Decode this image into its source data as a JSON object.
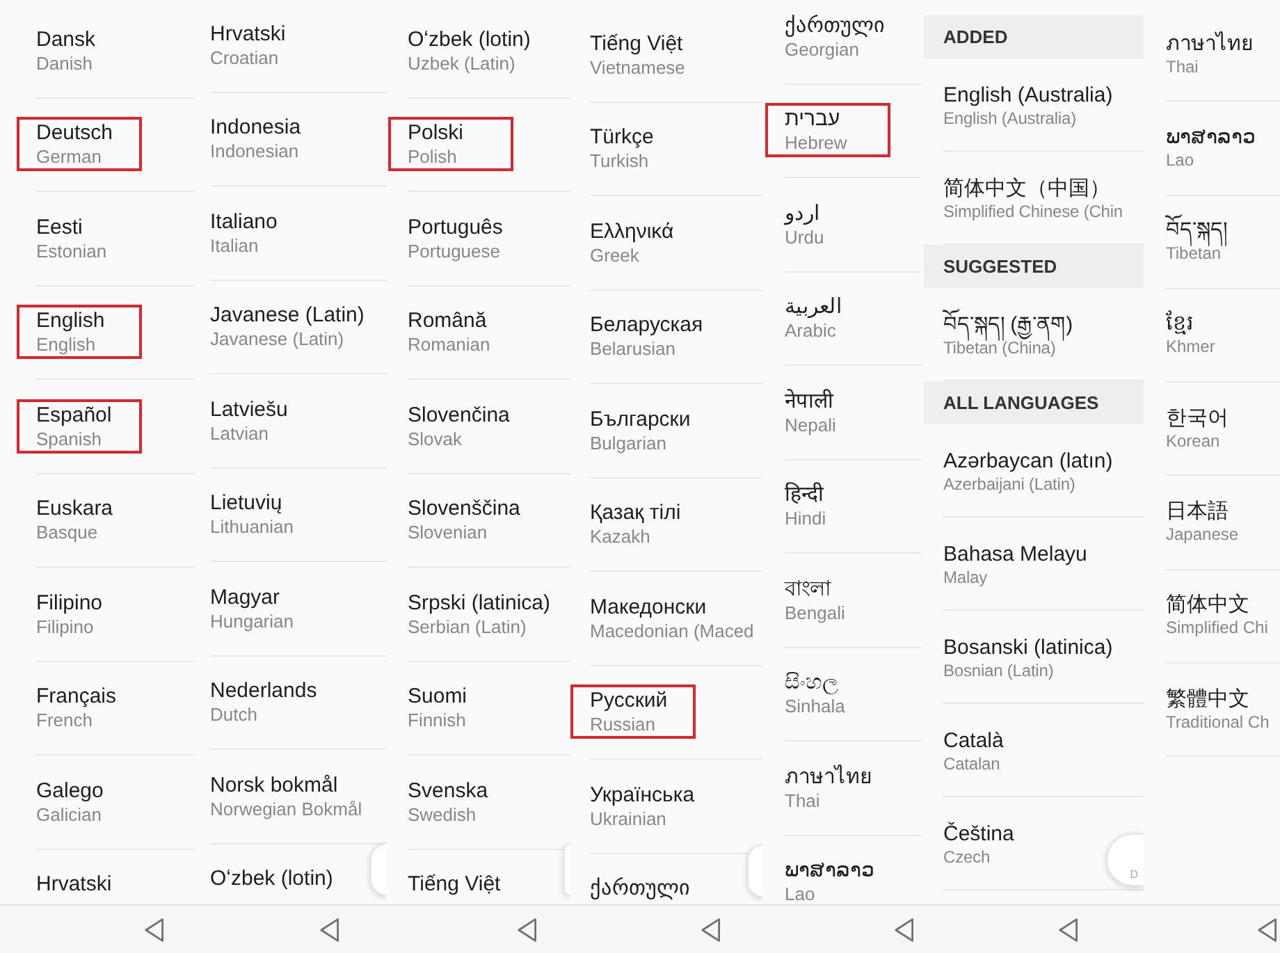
{
  "strips": [
    {
      "floating_button": false,
      "items": [
        {
          "kind": "language",
          "name": "Dansk",
          "english_name": "Danish",
          "highlighted": false
        },
        {
          "kind": "language",
          "name": "Deutsch",
          "english_name": "German",
          "highlighted": true
        },
        {
          "kind": "language",
          "name": "Eesti",
          "english_name": "Estonian",
          "highlighted": false
        },
        {
          "kind": "language",
          "name": "English",
          "english_name": "English",
          "highlighted": true
        },
        {
          "kind": "language",
          "name": "Español",
          "english_name": "Spanish",
          "highlighted": true
        },
        {
          "kind": "language",
          "name": "Euskara",
          "english_name": "Basque",
          "highlighted": false
        },
        {
          "kind": "language",
          "name": "Filipino",
          "english_name": "Filipino",
          "highlighted": false
        },
        {
          "kind": "language",
          "name": "Français",
          "english_name": "French",
          "highlighted": false
        },
        {
          "kind": "language",
          "name": "Galego",
          "english_name": "Galician",
          "highlighted": false
        },
        {
          "kind": "language",
          "name": "Hrvatski",
          "highlighted": false
        }
      ]
    },
    {
      "floating_button": true,
      "items": [
        {
          "kind": "language",
          "name": "Hrvatski",
          "english_name": "Croatian",
          "highlighted": false
        },
        {
          "kind": "language",
          "name": "Indonesia",
          "english_name": "Indonesian",
          "highlighted": false
        },
        {
          "kind": "language",
          "name": "Italiano",
          "english_name": "Italian",
          "highlighted": false
        },
        {
          "kind": "language",
          "name": "Javanese (Latin)",
          "english_name": "Javanese (Latin)",
          "highlighted": false
        },
        {
          "kind": "language",
          "name": "Latviešu",
          "english_name": "Latvian",
          "highlighted": false
        },
        {
          "kind": "language",
          "name": "Lietuvių",
          "english_name": "Lithuanian",
          "highlighted": false
        },
        {
          "kind": "language",
          "name": "Magyar",
          "english_name": "Hungarian",
          "highlighted": false
        },
        {
          "kind": "language",
          "name": "Nederlands",
          "english_name": "Dutch",
          "highlighted": false
        },
        {
          "kind": "language",
          "name": "Norsk bokmål",
          "english_name": "Norwegian Bokmål",
          "highlighted": false
        },
        {
          "kind": "language",
          "name": "Oʻzbek (lotin)",
          "highlighted": false
        }
      ]
    },
    {
      "floating_button": true,
      "items": [
        {
          "kind": "language",
          "name": "Oʻzbek (lotin)",
          "english_name": "Uzbek (Latin)",
          "highlighted": false
        },
        {
          "kind": "language",
          "name": "Polski",
          "english_name": "Polish",
          "highlighted": true
        },
        {
          "kind": "language",
          "name": "Português",
          "english_name": "Portuguese",
          "highlighted": false
        },
        {
          "kind": "language",
          "name": "Română",
          "english_name": "Romanian",
          "highlighted": false
        },
        {
          "kind": "language",
          "name": "Slovenčina",
          "english_name": "Slovak",
          "highlighted": false
        },
        {
          "kind": "language",
          "name": "Slovenščina",
          "english_name": "Slovenian",
          "highlighted": false
        },
        {
          "kind": "language",
          "name": "Srpski (latinica)",
          "english_name": "Serbian (Latin)",
          "highlighted": false
        },
        {
          "kind": "language",
          "name": "Suomi",
          "english_name": "Finnish",
          "highlighted": false
        },
        {
          "kind": "language",
          "name": "Svenska",
          "english_name": "Swedish",
          "highlighted": false
        },
        {
          "kind": "language",
          "name": "Tiếng Việt",
          "highlighted": false
        }
      ]
    },
    {
      "floating_button": true,
      "items": [
        {
          "kind": "language",
          "name": "Tiếng Việt",
          "english_name": "Vietnamese",
          "highlighted": false
        },
        {
          "kind": "language",
          "name": "Türkçe",
          "english_name": "Turkish",
          "highlighted": false
        },
        {
          "kind": "language",
          "name": "Ελληνικά",
          "english_name": "Greek",
          "highlighted": false
        },
        {
          "kind": "language",
          "name": "Беларуская",
          "english_name": "Belarusian",
          "highlighted": false
        },
        {
          "kind": "language",
          "name": "Български",
          "english_name": "Bulgarian",
          "highlighted": false
        },
        {
          "kind": "language",
          "name": "Қазақ тілі",
          "english_name": "Kazakh",
          "highlighted": false
        },
        {
          "kind": "language",
          "name": "Македонски",
          "english_name": "Macedonian (Maced",
          "highlighted": false
        },
        {
          "kind": "language",
          "name": "Русский",
          "english_name": "Russian",
          "highlighted": true
        },
        {
          "kind": "language",
          "name": "Українська",
          "english_name": "Ukrainian",
          "highlighted": false
        },
        {
          "kind": "language",
          "name": "ქართული",
          "highlighted": false
        }
      ]
    },
    {
      "floating_button": false,
      "items": [
        {
          "kind": "language",
          "name": "ქართული",
          "english_name": "Georgian",
          "highlighted": false
        },
        {
          "kind": "language",
          "name": "עברית",
          "english_name": "Hebrew",
          "highlighted": true
        },
        {
          "kind": "language",
          "name": "اردو",
          "english_name": "Urdu",
          "highlighted": false
        },
        {
          "kind": "language",
          "name": "العربية",
          "english_name": "Arabic",
          "highlighted": false
        },
        {
          "kind": "language",
          "name": "नेपाली",
          "english_name": "Nepali",
          "highlighted": false
        },
        {
          "kind": "language",
          "name": "हिन्दी",
          "english_name": "Hindi",
          "highlighted": false
        },
        {
          "kind": "language",
          "name": "বাংলা",
          "english_name": "Bengali",
          "highlighted": false
        },
        {
          "kind": "language",
          "name": "සිංහල",
          "english_name": "Sinhala",
          "highlighted": false
        },
        {
          "kind": "language",
          "name": "ภาษาไทย",
          "english_name": "Thai",
          "highlighted": false
        },
        {
          "kind": "language",
          "name": "ພາສາລາວ",
          "english_name": "Lao",
          "highlighted": false
        }
      ]
    },
    {
      "floating_button": true,
      "floating_button_label": "D",
      "items": [
        {
          "kind": "header",
          "label": "ADDED"
        },
        {
          "kind": "language",
          "name": "English (Australia)",
          "english_name": "English (Australia)",
          "highlighted": false
        },
        {
          "kind": "language",
          "name": "简体中文（中国）",
          "english_name": "Simplified Chinese (Chin",
          "highlighted": false
        },
        {
          "kind": "header",
          "label": "SUGGESTED"
        },
        {
          "kind": "language",
          "name": "བོད་སྐད། (རྒྱ་ནག)",
          "english_name": "Tibetan (China)",
          "highlighted": false
        },
        {
          "kind": "header",
          "label": "ALL LANGUAGES"
        },
        {
          "kind": "language",
          "name": "Azərbaycan (latın)",
          "english_name": "Azerbaijani (Latin)",
          "highlighted": false
        },
        {
          "kind": "language",
          "name": "Bahasa Melayu",
          "english_name": "Malay",
          "highlighted": false
        },
        {
          "kind": "language",
          "name": "Bosanski (latinica)",
          "english_name": "Bosnian (Latin)",
          "highlighted": false
        },
        {
          "kind": "language",
          "name": "Català",
          "english_name": "Catalan",
          "highlighted": false
        },
        {
          "kind": "language",
          "name": "Čeština",
          "english_name": "Czech",
          "highlighted": false
        }
      ]
    },
    {
      "floating_button": false,
      "items": [
        {
          "kind": "language",
          "name": "ภาษาไทย",
          "english_name": "Thai",
          "highlighted": false
        },
        {
          "kind": "language",
          "name": "ພາສາລາວ",
          "english_name": "Lao",
          "highlighted": false
        },
        {
          "kind": "language",
          "name": "བོད་སྐད།",
          "english_name": "Tibetan",
          "highlighted": false
        },
        {
          "kind": "language",
          "name": "ខ្មែរ",
          "english_name": "Khmer",
          "highlighted": false
        },
        {
          "kind": "language",
          "name": "한국어",
          "english_name": "Korean",
          "highlighted": false
        },
        {
          "kind": "language",
          "name": "日本語",
          "english_name": "Japanese",
          "highlighted": false
        },
        {
          "kind": "language",
          "name": "简体中文",
          "english_name": "Simplified Chi",
          "highlighted": false
        },
        {
          "kind": "language",
          "name": "繁體中文",
          "english_name": "Traditional Ch",
          "highlighted": false
        }
      ]
    }
  ]
}
